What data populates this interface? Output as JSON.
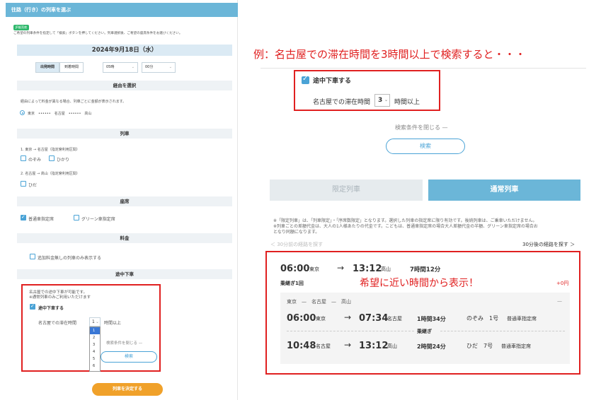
{
  "left": {
    "header": "往路（行き）の列車を選ぶ",
    "tag": "JR販売席",
    "intro": "ご希望の列車条件を指定して「検索」ボタンを押してください。列車選択後、ご希望の座席条件をお選びください。",
    "date": "2024年9月18日（水）",
    "time_mode": {
      "depart": "出発時間",
      "arrive": "到着時間"
    },
    "hour": "05時",
    "minute": "00分",
    "route_section": {
      "title": "経由を選択",
      "note": "経由によって料金が異なる場合、列車ごとに金額が表示されます。",
      "option": "東京　••••••　名古屋　••••••　高山"
    },
    "train_section": {
      "title": "列車",
      "seg1": "1. 東京 → 名古屋（指定席利用区間）",
      "seg1_options": [
        "のぞみ",
        "ひかり"
      ],
      "seg2": "2. 名古屋 → 高山（指定席利用区間）",
      "seg2_options": [
        "ひだ"
      ]
    },
    "seat_section": {
      "title": "座席",
      "options": [
        "普通車指定席",
        "グリーン車指定席"
      ]
    },
    "fare_section": {
      "title": "料金",
      "option": "追加料金無しの列車のみ表示する"
    },
    "stopover_section": {
      "title": "途中下車",
      "note1": "名古屋での途中下車が可能です。",
      "note2": "※通常列車のみご利用いただけます",
      "checkbox": "途中下車する",
      "stay_label": "名古屋での滞在時間",
      "stay_value": "1",
      "stay_suffix": "時間以上",
      "dropdown_options": [
        "1",
        "2",
        "3",
        "4",
        "5",
        "6"
      ],
      "close_label": "検索条件を閉じる —",
      "search": "検索"
    },
    "decide_button": "列車を決定する"
  },
  "right": {
    "caption": "例：名古屋での滞在時間を3時間以上で検索すると・・・",
    "checkbox": "途中下車する",
    "stay_label": "名古屋での滞在時間",
    "stay_value": "3",
    "stay_suffix": "時間以上",
    "close_label": "検索条件を閉じる —",
    "search": "検索",
    "tabs": {
      "limited": "限定列車",
      "normal": "通常列車"
    },
    "note1": "※「限定列車」は、「列車限定」・「序席数限定」となります。選択した列車の指定席に限り有効です。後続列車は、ご乗車いただけません。",
    "note2": "※列車ごとの差額代金は、大人の1人様あたりの代金です。こどもは、普通車指定席の場合大人差額代金の半額、グリーン車指定席の場合お",
    "note3": "となり同額になります。",
    "prev_link": "＜  30分前の経路を探す",
    "next_link": "30分後の経路を探す ＞",
    "result": {
      "depart_time": "06:00",
      "depart_station": "東京",
      "arrive_time": "13:12",
      "arrive_station": "高山",
      "duration": "7時間12分",
      "transfers": "乗継ぎ1回",
      "price_diff": "+0円",
      "highlight": "希望に近い時間から表示！",
      "route": "東京　—　名古屋　—　高山",
      "collapse": "—",
      "legs": [
        {
          "dep_time": "06:00",
          "dep_station": "東京",
          "arr_time": "07:34",
          "arr_station": "名古屋",
          "duration": "1時間34分",
          "train": "のぞみ　1号",
          "seat": "普通車指定席"
        },
        {
          "dep_time": "10:48",
          "dep_station": "名古屋",
          "arr_time": "13:12",
          "arr_station": "高山",
          "duration": "2時間24分",
          "train": "ひだ　7号",
          "seat": "普通車指定席"
        }
      ],
      "transfer_label": "乗継ぎ"
    }
  },
  "colors": {
    "accent": "#6bb6d8",
    "highlight_red": "#e02020",
    "orange": "#f0a12a"
  }
}
